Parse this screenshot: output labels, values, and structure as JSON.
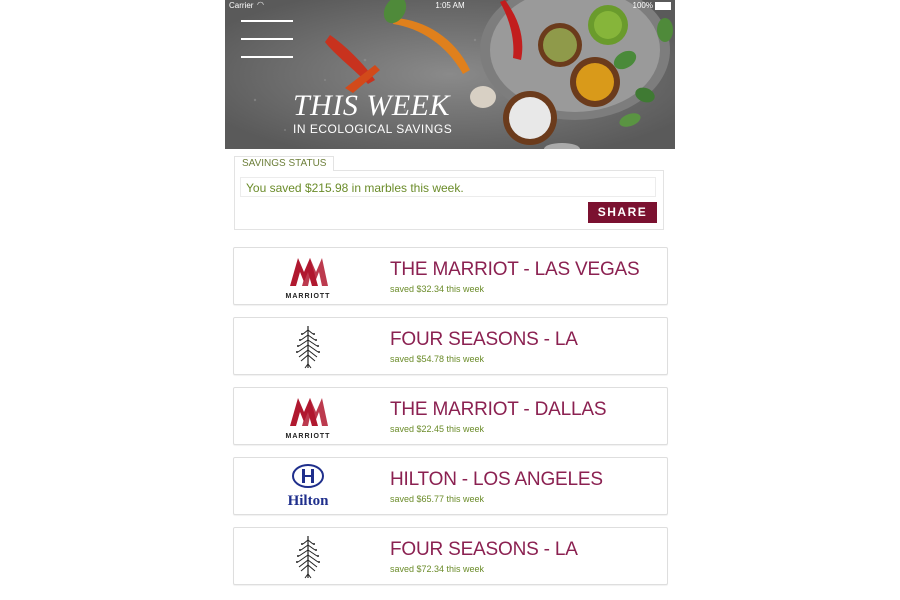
{
  "status_bar": {
    "carrier": "Carrier",
    "wifi_icon": "wifi-icon",
    "time": "1:05 AM",
    "battery": "100%"
  },
  "hero": {
    "title": "THIS WEEK",
    "subtitle": "IN ECOLOGICAL SAVINGS"
  },
  "savings_status": {
    "tab_label": "SAVINGS STATUS",
    "message": "You saved $215.98 in marbles this week.",
    "share_label": "SHARE"
  },
  "hotels": [
    {
      "name": "THE MARRIOT - LAS VEGAS",
      "saved": "saved $32.34 this week",
      "logo": "marriott-logo",
      "logo_text": "MARRIOTT"
    },
    {
      "name": "FOUR SEASONS - LA",
      "saved": "saved $54.78 this week",
      "logo": "four-seasons-logo"
    },
    {
      "name": "THE MARRIOT - DALLAS",
      "saved": "saved $22.45 this week",
      "logo": "marriott-logo",
      "logo_text": "MARRIOTT"
    },
    {
      "name": "HILTON - LOS ANGELES",
      "saved": "saved $65.77 this week",
      "logo": "hilton-logo",
      "logo_text": "Hilton"
    },
    {
      "name": "FOUR SEASONS - LA",
      "saved": "saved $72.34 this week",
      "logo": "four-seasons-logo"
    }
  ],
  "colors": {
    "accent": "#8b2151",
    "share_bg": "#7b1130",
    "green_text": "#6b8c2a",
    "marriott_red": "#b0182f",
    "hilton_blue": "#1f2f8c"
  }
}
